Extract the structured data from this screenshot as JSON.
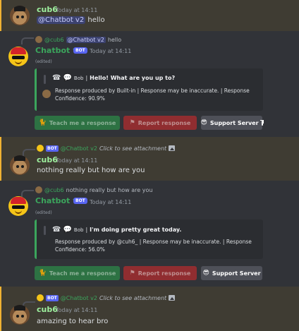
{
  "messages": [
    {
      "author": "cub6",
      "time": "Today at 14:11",
      "mention": "@Chatbot v2",
      "text": "hello"
    },
    {
      "reply_author": "@cub6",
      "reply_mention": "@Chatbot v2",
      "reply_text": "hello",
      "author": "Chatbot v2",
      "tag": "BOT",
      "time": "Today at 14:11",
      "edited": "(edited)",
      "embed_name": "Bob",
      "embed_sep": "|",
      "embed_headline": "Hello! What are you up to?",
      "embed_footer": "Response produced by Built-in | Response may be inaccurate. | Response Confidence: 90.9%",
      "buttons": {
        "teach": "Teach me a response",
        "report": "Report response",
        "support": "Support Server"
      }
    },
    {
      "reply_tag": "BOT",
      "reply_author": "@Chatbot v2",
      "reply_text": "Click to see attachment",
      "author": "cub6",
      "time": "Today at 14:11",
      "text": "nothing really but how are you"
    },
    {
      "reply_author": "@cub6",
      "reply_text": "nothing really but how are you",
      "author": "Chatbot v2",
      "tag": "BOT",
      "time": "Today at 14:11",
      "edited": "(edited)",
      "embed_name": "Bob",
      "embed_sep": "|",
      "embed_headline": "I'm doing pretty great today.",
      "embed_footer": "Response produced by @cuh6_ | Response may be inaccurate. | Response Confidence: 56.0%",
      "buttons": {
        "teach": "Teach me a response",
        "report": "Report response",
        "support": "Support Server"
      }
    },
    {
      "reply_tag": "BOT",
      "reply_author": "@Chatbot v2",
      "reply_text": "Click to see attachment",
      "author": "cub6",
      "time": "Today at 14:11",
      "text": "amazing to hear bro"
    }
  ],
  "icons": {
    "robot": "robot-icon",
    "speech": "speech-bubble-icon",
    "teach": "cat-icon",
    "report": "flag-icon",
    "support": "sunglasses-emoji-icon",
    "external": "external-link-icon",
    "image": "image-icon"
  },
  "colors": {
    "background": "#313338",
    "mention_highlight": "#3f3c33",
    "embed_border": "#3ba55c",
    "bot_tag": "#5865f2",
    "teach_button": "#2d7d46",
    "report_button": "#a12d2f",
    "support_button": "#4e5058"
  }
}
